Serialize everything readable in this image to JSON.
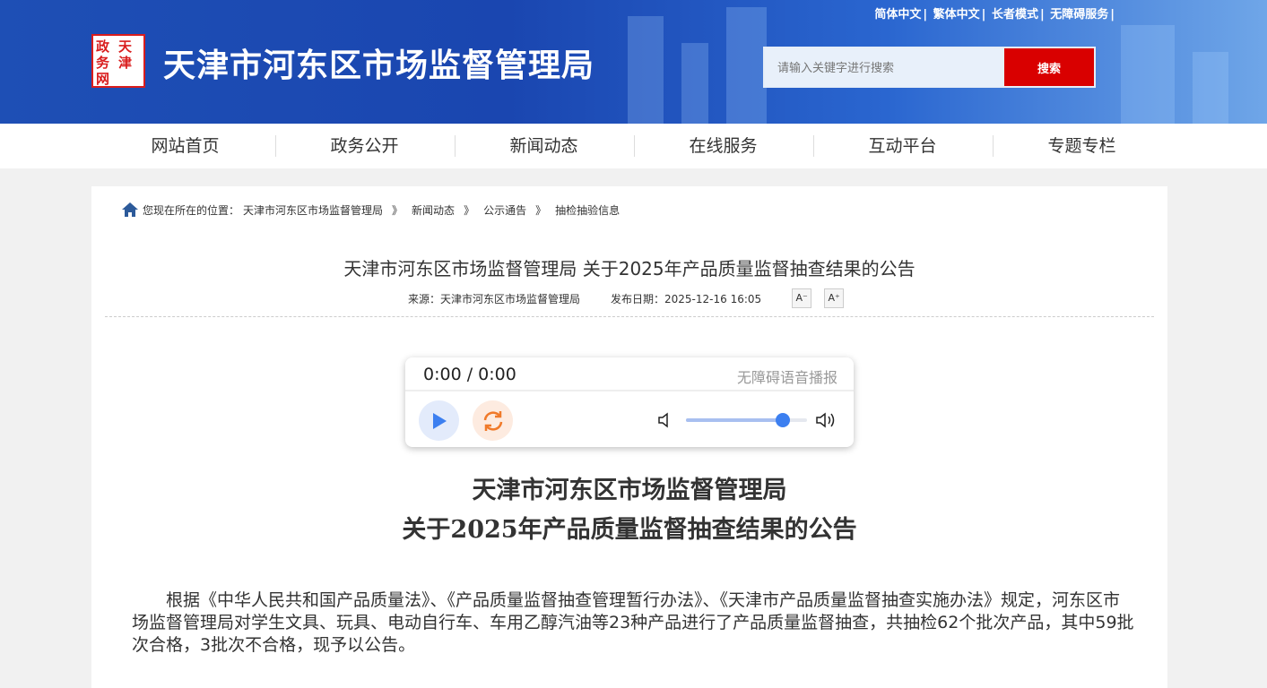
{
  "header": {
    "top_links": [
      "简体中文",
      "繁体中文",
      "长者模式",
      "无障碍服务"
    ],
    "logo_text": "天津政务网",
    "site_title": "天津市河东区市场监督管理局",
    "search_placeholder": "请输入关键字进行搜索",
    "search_button": "搜索"
  },
  "nav": [
    "网站首页",
    "政务公开",
    "新闻动态",
    "在线服务",
    "互动平台",
    "专题专栏"
  ],
  "breadcrumb": {
    "prefix": "您现在所在的位置：",
    "items": [
      "天津市河东区市场监督管理局",
      "新闻动态",
      "公示通告",
      "抽检抽验信息"
    ],
    "sep": "》"
  },
  "article": {
    "title": "天津市河东区市场监督管理局 关于2025年产品质量监督抽查结果的公告",
    "source": "来源：天津市河东区市场监督管理局",
    "date": "发布日期：2025-12-16 16:05",
    "font_minus": "A⁻",
    "font_plus": "A⁺",
    "heading_line1": "天津市河东区市场监督管理局",
    "heading_line2": "关于2025年产品质量监督抽查结果的公告",
    "body": "根据《中华人民共和国产品质量法》、《产品质量监督抽查管理暂行办法》、《天津市产品质量监督抽查实施办法》规定，河东区市场监督管理局对学生文具、玩具、电动自行车、车用乙醇汽油等23种产品进行了产品质量监督抽查，共抽检62个批次产品，其中59批次合格，3批次不合格，现予以公告。"
  },
  "player": {
    "time": "0:00 / 0:00",
    "label": "无障碍语音播报",
    "volume": 0.8
  }
}
